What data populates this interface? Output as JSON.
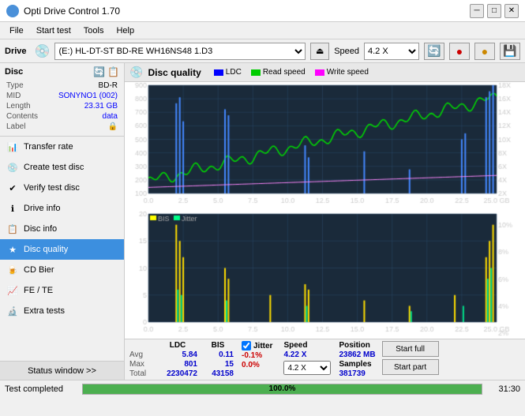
{
  "titleBar": {
    "title": "Opti Drive Control 1.70",
    "minBtn": "─",
    "maxBtn": "□",
    "closeBtn": "✕"
  },
  "menuBar": {
    "items": [
      "File",
      "Start test",
      "Tools",
      "Help"
    ]
  },
  "driveBar": {
    "driveLabel": "Drive",
    "driveValue": "(E:)  HL-DT-ST BD-RE  WH16NS48 1.D3",
    "speedLabel": "Speed",
    "speedValue": "4.2 X"
  },
  "sidebar": {
    "discTitle": "Disc",
    "discInfo": {
      "typeLabel": "Type",
      "typeValue": "BD-R",
      "midLabel": "MID",
      "midValue": "SONYNO1 (002)",
      "lengthLabel": "Length",
      "lengthValue": "23.31 GB",
      "contentsLabel": "Contents",
      "contentsValue": "data",
      "labelLabel": "Label",
      "labelValue": ""
    },
    "navItems": [
      {
        "id": "transfer-rate",
        "label": "Transfer rate",
        "icon": "📊"
      },
      {
        "id": "create-test-disc",
        "label": "Create test disc",
        "icon": "💿"
      },
      {
        "id": "verify-test-disc",
        "label": "Verify test disc",
        "icon": "✔"
      },
      {
        "id": "drive-info",
        "label": "Drive info",
        "icon": "ℹ"
      },
      {
        "id": "disc-info",
        "label": "Disc info",
        "icon": "📋"
      },
      {
        "id": "disc-quality",
        "label": "Disc quality",
        "icon": "★",
        "active": true
      },
      {
        "id": "cd-bier",
        "label": "CD Bier",
        "icon": "🍺"
      },
      {
        "id": "fe-te",
        "label": "FE / TE",
        "icon": "📈"
      },
      {
        "id": "extra-tests",
        "label": "Extra tests",
        "icon": "🔬"
      }
    ],
    "statusWindow": "Status window >>"
  },
  "discQuality": {
    "title": "Disc quality",
    "legend": {
      "ldc": "LDC",
      "readSpeed": "Read speed",
      "writeSpeed": "Write speed"
    }
  },
  "stats": {
    "columns": [
      "LDC",
      "BIS"
    ],
    "jitterLabel": "Jitter",
    "jitterChecked": true,
    "rows": [
      {
        "label": "Avg",
        "ldc": "5.84",
        "bis": "0.11",
        "jitter": "-0.1%"
      },
      {
        "label": "Max",
        "ldc": "801",
        "bis": "15",
        "jitter": "0.0%"
      },
      {
        "label": "Total",
        "ldc": "2230472",
        "bis": "43158",
        "jitter": ""
      }
    ],
    "speed": {
      "label": "Speed",
      "value": "4.22 X"
    },
    "speedSelect": "4.2 X",
    "position": {
      "label": "Position",
      "value": "23862 MB",
      "samplesLabel": "Samples",
      "samplesValue": "381739"
    },
    "buttons": {
      "startFull": "Start full",
      "startPart": "Start part"
    }
  },
  "bottomBar": {
    "statusLabel": "Test completed",
    "progress": 100,
    "progressText": "100.0%",
    "time": "31:30"
  },
  "chart1": {
    "yMax": 900,
    "yMin": 0,
    "xMax": 25,
    "yAxisRight": [
      "18X",
      "16X",
      "14X",
      "12X",
      "10X",
      "8X",
      "6X",
      "4X",
      "2X"
    ],
    "xLabels": [
      "0.0",
      "2.5",
      "5.0",
      "7.5",
      "10.0",
      "12.5",
      "15.0",
      "17.5",
      "20.0",
      "22.5",
      "25.0 GB"
    ]
  },
  "chart2": {
    "yMax": 20,
    "yMin": 0,
    "xMax": 25,
    "yAxisRight": [
      "10%",
      "8%",
      "6%",
      "4%",
      "2%"
    ],
    "xLabels": [
      "0.0",
      "2.5",
      "5.0",
      "7.5",
      "10.0",
      "12.5",
      "15.0",
      "17.5",
      "20.0",
      "22.5",
      "25.0 GB"
    ],
    "legend": {
      "bis": "BIS",
      "jitter": "Jitter"
    }
  }
}
